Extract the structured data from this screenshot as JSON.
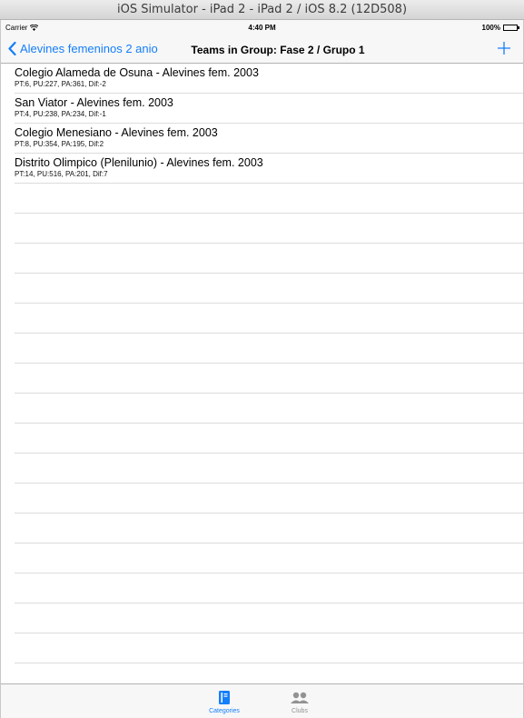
{
  "simulator": {
    "title": "iOS Simulator - iPad 2 - iPad 2 / iOS 8.2 (12D508)"
  },
  "status_bar": {
    "carrier": "Carrier",
    "time": "4:40 PM",
    "battery": "100%"
  },
  "nav": {
    "back_label": "Alevines femeninos 2 anio",
    "title": "Teams in Group: Fase 2 / Grupo 1",
    "add_label": "+"
  },
  "teams": [
    {
      "name": "Colegio Alameda de Osuna - Alevines fem. 2003",
      "stats": "PT:6, PU:227, PA:361, Dif:-2"
    },
    {
      "name": "San Viator - Alevines fem. 2003",
      "stats": "PT:4, PU:238, PA:234, Dif:-1"
    },
    {
      "name": "Colegio Menesiano - Alevines fem. 2003",
      "stats": "PT:8, PU:354, PA:195, Dif:2"
    },
    {
      "name": "Distrito Olimpico (Plenilunio) - Alevines fem. 2003",
      "stats": "PT:14, PU:516, PA:201, Dif:7"
    }
  ],
  "tab_bar": {
    "tabs": [
      {
        "label": "Categories",
        "icon": "book-icon",
        "selected": true
      },
      {
        "label": "Clubs",
        "icon": "people-icon",
        "selected": false
      }
    ]
  },
  "colors": {
    "accent": "#147efb",
    "inactive": "#929292"
  }
}
